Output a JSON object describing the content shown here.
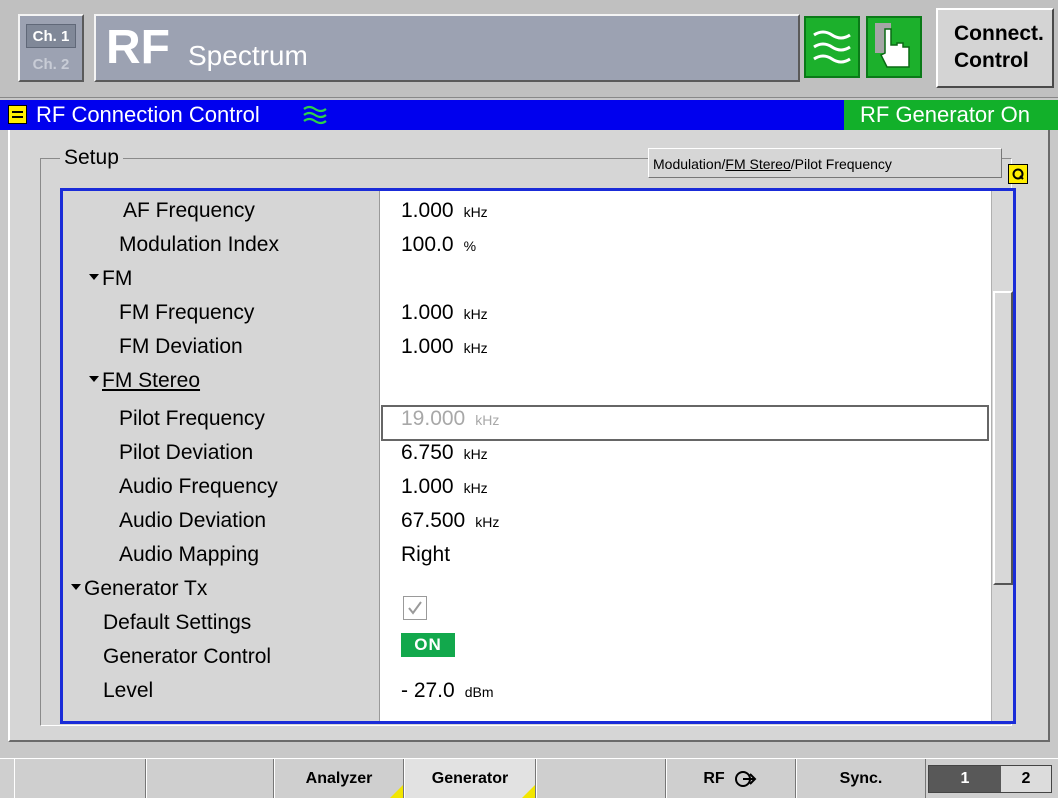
{
  "header": {
    "ch1": "Ch. 1",
    "ch2": "Ch. 2",
    "app_big": "RF",
    "app_sub": "Spectrum",
    "connect_line1": "Connect.",
    "connect_line2": "Control"
  },
  "titlebar": {
    "title": "RF Connection Control",
    "status": "RF Generator On"
  },
  "setup": {
    "label": "Setup",
    "path": {
      "part1": "Modulation/",
      "part2": "FM Stereo",
      "part3": "/Pilot Frequency"
    }
  },
  "rows": [
    {
      "label": "AF Frequency",
      "value": "1.000",
      "unit": "kHz"
    },
    {
      "label": "Modulation Index",
      "value": "100.0",
      "unit": "%"
    },
    {
      "label": "FM"
    },
    {
      "label": "FM Frequency",
      "value": "1.000",
      "unit": "kHz"
    },
    {
      "label": "FM Deviation",
      "value": "1.000",
      "unit": "kHz"
    },
    {
      "label": "FM Stereo"
    },
    {
      "label": "Pilot Frequency",
      "value": "19.000",
      "unit": "kHz"
    },
    {
      "label": "Pilot Deviation",
      "value": "6.750",
      "unit": "kHz"
    },
    {
      "label": "Audio Frequency",
      "value": "1.000",
      "unit": "kHz"
    },
    {
      "label": "Audio Deviation",
      "value": "67.500",
      "unit": "kHz"
    },
    {
      "label": "Audio Mapping",
      "value": "Right"
    },
    {
      "label": "Generator Tx"
    },
    {
      "label": "Default Settings",
      "checked": true
    },
    {
      "label": "Generator Control",
      "value": "ON"
    },
    {
      "label": "Level",
      "value": "- 27.0",
      "unit": "dBm"
    }
  ],
  "softkeys": {
    "analyzer": "Analyzer",
    "generator": "Generator",
    "rf": "RF",
    "sync": "Sync.",
    "page1": "1",
    "page2": "2"
  },
  "colors": {
    "title_bar": "#0000ee",
    "status_green": "#12b02a",
    "on_badge": "#12a84c",
    "tree_border": "#1a2cd8"
  },
  "icons": {
    "rf_wave": "rf-wave-icon",
    "hand": "hand-pointer-icon",
    "menu": "menu-icon",
    "refresh": "refresh-icon",
    "rf_output": "rf-output-icon"
  }
}
